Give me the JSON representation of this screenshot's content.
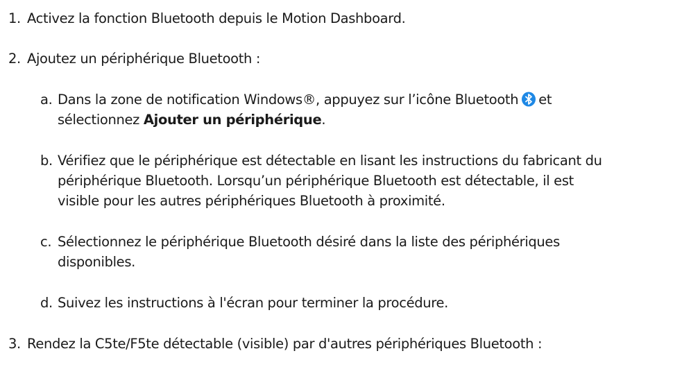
{
  "steps": [
    {
      "number": "1.",
      "text": "Activez la fonction Bluetooth depuis le Motion Dashboard."
    },
    {
      "number": "2.",
      "text": "Ajoutez un périphérique Bluetooth :",
      "substeps": [
        {
          "letter": "a.",
          "line1_before_icon": "Dans la zone de notification Windows®, appuyez sur l’icône Bluetooth",
          "icon": "bluetooth-icon",
          "line1_after_icon": "et",
          "line2_before_bold": "sélectionnez ",
          "line2_bold": "Ajouter un périphérique",
          "line2_after_bold": "."
        },
        {
          "letter": "b.",
          "lines": [
            "Vérifiez que le périphérique est détectable en lisant les instructions du fabricant du",
            "périphérique Bluetooth. Lorsqu’un périphérique Bluetooth est détectable, il est",
            "visible pour les autres périphériques Bluetooth à proximité."
          ]
        },
        {
          "letter": "c.",
          "lines": [
            "Sélectionnez le périphérique Bluetooth désiré dans la liste des périphériques",
            "disponibles."
          ]
        },
        {
          "letter": "d.",
          "lines": [
            "Suivez les instructions à l'écran pour terminer la procédure."
          ]
        }
      ]
    },
    {
      "number": "3.",
      "text": "Rendez la C5te/F5te détectable (visible) par d'autres périphériques Bluetooth :"
    }
  ],
  "colors": {
    "text": "#1a1a1a",
    "bluetooth_icon_bg": "#1e88e5",
    "bluetooth_icon_fg": "#ffffff"
  }
}
